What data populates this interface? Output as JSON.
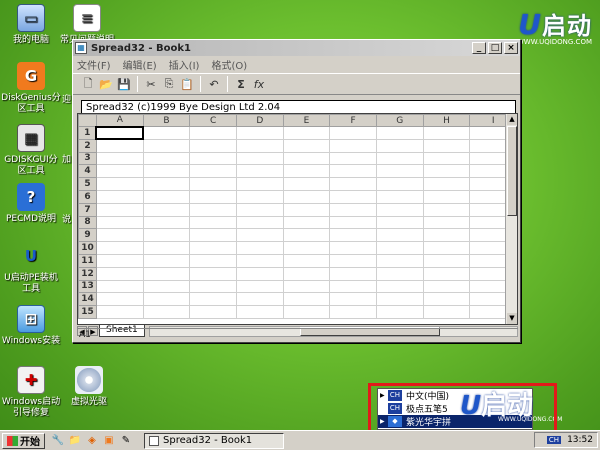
{
  "desktop": {
    "icons": [
      {
        "label": "我的电脑",
        "glyph": "▭"
      },
      {
        "label": "常见问题说明",
        "glyph": "≡"
      },
      {
        "label": "DiskGenius分区工具",
        "glyph": "G"
      },
      {
        "label": "GDISKGUI分区工具",
        "glyph": "▦"
      },
      {
        "label": "PECMD说明",
        "glyph": "?"
      },
      {
        "label": "U启动PE装机工具",
        "glyph": "U"
      },
      {
        "label": "Windows安装",
        "glyph": "⊞"
      },
      {
        "label": "Windows启动引导修复",
        "glyph": "✚"
      },
      {
        "label": "虚拟光驱",
        "glyph": "◎"
      }
    ],
    "partial_labels": [
      "迎",
      "加",
      "说"
    ]
  },
  "logo": {
    "mark": "U",
    "text": "启动",
    "url": "WWW.UQIDONG.COM"
  },
  "window": {
    "title": "Spread32 - Book1",
    "controls": {
      "minimize": "_",
      "maximize": "□",
      "close": "×"
    },
    "menu": [
      "文件(F)",
      "编辑(E)",
      "插入(I)",
      "格式(O)"
    ],
    "toolbar": [
      "new-file",
      "open-folder",
      "save",
      "cut",
      "copy",
      "paste",
      "undo",
      "sum",
      "function"
    ],
    "toolbar_glyphs": [
      "🗋",
      "📂",
      "💾",
      "✂",
      "⎘",
      "📋",
      "↶",
      "Σ",
      "fx"
    ],
    "formula_text": "Spread32 (c)1999 Bye Design Ltd  2.04",
    "columns": [
      "A",
      "B",
      "C",
      "D",
      "E",
      "F",
      "G",
      "H",
      "I"
    ],
    "rows": [
      "1",
      "2",
      "3",
      "4",
      "5",
      "6",
      "7",
      "8",
      "9",
      "10",
      "11",
      "12",
      "13",
      "14",
      "15"
    ],
    "sheet_tab": "Sheet1",
    "status": "A1",
    "active_cell": "A1"
  },
  "popup": {
    "items": [
      {
        "badge": "CH",
        "label": "中文(中国)"
      },
      {
        "badge": "CH",
        "label": "极点五笔5"
      },
      {
        "badge": "◆",
        "label": "紫光华宇拼"
      }
    ],
    "selected_index": 2,
    "logo_mark": "U",
    "logo_text": "启动",
    "logo_url": "WWW.UQIDONG.COM"
  },
  "taskbar": {
    "start_label": "开始",
    "task_button": "Spread32 - Book1",
    "tray_lang": "CH",
    "clock": "13:52"
  }
}
